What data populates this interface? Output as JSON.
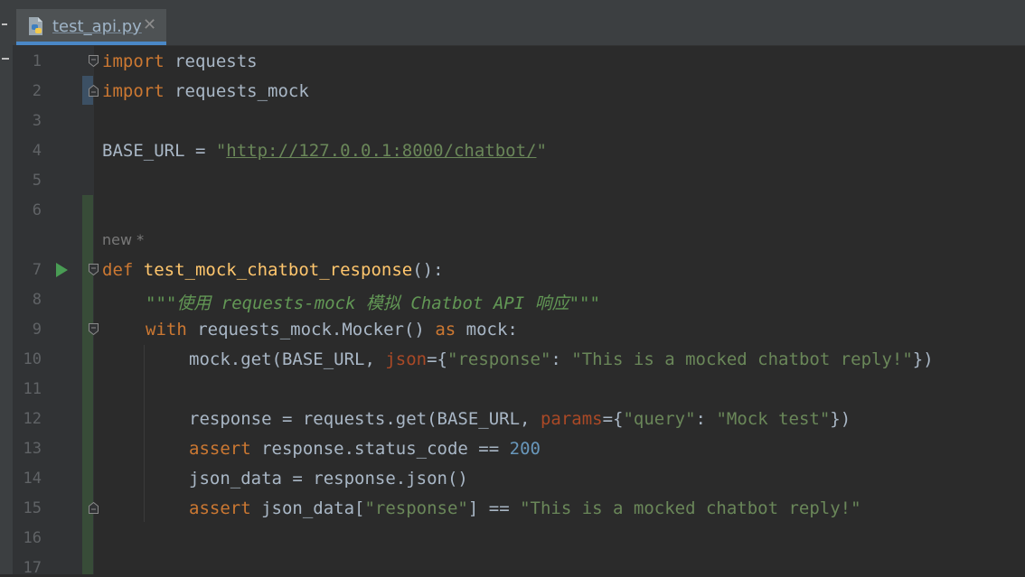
{
  "tab": {
    "label": "test_api.py",
    "close": "✕"
  },
  "inlay_hint": "new *",
  "lines": [
    "1",
    "2",
    "3",
    "4",
    "5",
    "6",
    "7",
    "8",
    "9",
    "10",
    "11",
    "12",
    "13",
    "14",
    "15",
    "16",
    "17"
  ],
  "code": {
    "l1": {
      "kw": "import",
      "rest": " requests"
    },
    "l2": {
      "kw": "import",
      "rest": " requests_mock"
    },
    "l4": {
      "var": "BASE_URL = ",
      "q1": "\"",
      "url": "http://127.0.0.1:8000/chatbot/",
      "q2": "\""
    },
    "l7": {
      "kw": "def",
      "fn": "test_mock_chatbot_response",
      "rest": "():"
    },
    "l8": {
      "doc": "\"\"\"使用 requests-mock 模拟 Chatbot API 响应\"\"\""
    },
    "l9": {
      "kw": "with",
      "a": " requests_mock.Mocker() ",
      "kw2": "as",
      "b": " mock:"
    },
    "l10": {
      "a": "mock.get(BASE_URL, ",
      "param": "json",
      "b": "={",
      "s1": "\"response\"",
      "c": ": ",
      "s2": "\"This is a mocked chatbot reply!\"",
      "d": "})"
    },
    "l12": {
      "a": "response = requests.get(BASE_URL, ",
      "param": "params",
      "b": "={",
      "s1": "\"query\"",
      "c": ": ",
      "s2": "\"Mock test\"",
      "d": "})"
    },
    "l13": {
      "kw": "assert",
      "a": " response.status_code == ",
      "num": "200"
    },
    "l14": {
      "a": "json_data = response.json()"
    },
    "l15": {
      "kw": "assert",
      "a": " json_data[",
      "s1": "\"response\"",
      "b": "] == ",
      "s2": "\"This is a mocked chatbot reply!\""
    }
  },
  "colors": {
    "background": "#2b2b2b",
    "keyword": "#cc7832",
    "string": "#6a8759",
    "function": "#ffc66d",
    "number": "#6897bb",
    "run_icon": "#499c54"
  },
  "icons": {
    "tab": "python-file-icon",
    "run": "run-gutter-icon",
    "fold": "fold-marker-icon"
  }
}
